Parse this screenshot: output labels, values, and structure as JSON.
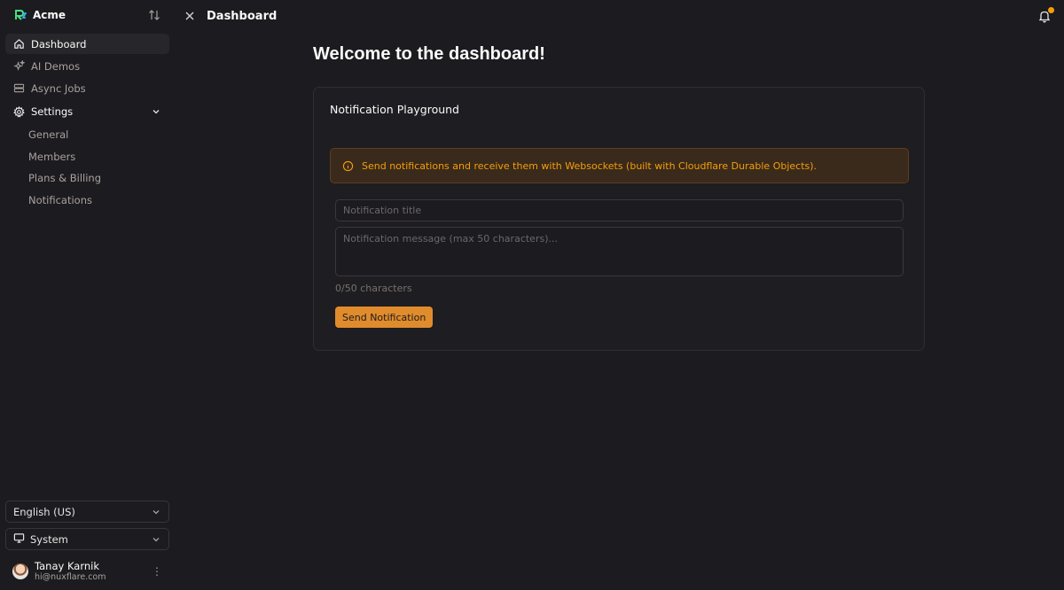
{
  "brand": {
    "name": "Acme"
  },
  "sidebar": {
    "items": [
      {
        "label": "Dashboard",
        "icon": "home-icon",
        "active": true
      },
      {
        "label": "AI Demos",
        "icon": "sparkles-icon"
      },
      {
        "label": "Async Jobs",
        "icon": "database-icon"
      }
    ],
    "settings": {
      "label": "Settings",
      "children": [
        "General",
        "Members",
        "Plans & Billing",
        "Notifications"
      ]
    },
    "language": "English (US)",
    "theme": "System",
    "user": {
      "name": "Tanay Karnik",
      "email": "hi@nuxflare.com"
    }
  },
  "header": {
    "title": "Dashboard",
    "notification_dot_color": "#f59e0b"
  },
  "main": {
    "welcome": "Welcome to the dashboard!",
    "card": {
      "title": "Notification Playground",
      "alert": "Send notifications and receive them with Websockets (built with Cloudflare Durable Objects).",
      "title_placeholder": "Notification title",
      "message_placeholder": "Notification message (max 50 characters)...",
      "char_count": "0/50 characters",
      "send_label": "Send Notification"
    }
  },
  "colors": {
    "accent": "#e08c2c",
    "alert_text": "#f59e0b"
  }
}
